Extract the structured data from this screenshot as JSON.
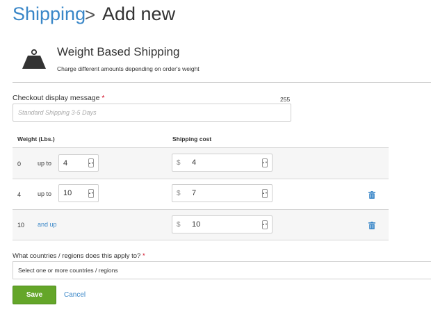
{
  "breadcrumb": {
    "parent": "Shipping",
    "separator": ">",
    "current": "Add new"
  },
  "method": {
    "title": "Weight Based Shipping",
    "description": "Charge different amounts depending on order's weight",
    "icon": "weight-icon"
  },
  "checkout_message": {
    "label": "Checkout display message",
    "required_mark": "*",
    "char_limit": "255",
    "placeholder": "Standard Shipping 3-5 Days",
    "value": ""
  },
  "table": {
    "headers": {
      "weight": "Weight (Lbs.)",
      "cost": "Shipping cost"
    },
    "rows": [
      {
        "from": "0",
        "connector": "up to",
        "to": "4",
        "currency": "$",
        "cost": "4",
        "deletable": false
      },
      {
        "from": "4",
        "connector": "up to",
        "to": "10",
        "currency": "$",
        "cost": "7",
        "deletable": true
      },
      {
        "from": "10",
        "connector": "and up",
        "to": "",
        "currency": "$",
        "cost": "10",
        "deletable": true
      }
    ]
  },
  "countries": {
    "label": "What countries / regions does this apply to?",
    "required_mark": "*",
    "placeholder": "Select one or more countries / regions"
  },
  "actions": {
    "save": "Save",
    "cancel": "Cancel"
  },
  "colors": {
    "link": "#3a87c8",
    "save_button": "#64a629",
    "required": "#d0021b",
    "row_highlight": "#f6f6f6"
  }
}
